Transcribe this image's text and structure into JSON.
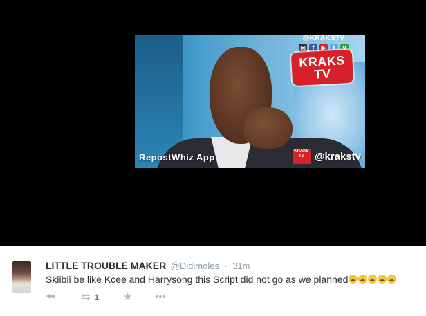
{
  "media": {
    "watermark_top_handle": "@KRAKSTV",
    "badge_line1": "KRAKS",
    "badge_line2": "TV",
    "watermark_left": "RepostWhiz App",
    "mini_badge_text": "KRAKS TV",
    "watermark_handle": "@krakstv"
  },
  "tweet": {
    "fullname": "LITTLE TROUBLE MAKER",
    "username": "@Didimoles",
    "separator": "·",
    "time": "31m",
    "text": "Skiibii be like Kcee and Harrysong this Script did not go as we planned",
    "emoji_count": 5,
    "retweet_count": "1"
  },
  "icons": {
    "reply": "reply-icon",
    "retweet": "retweet-icon",
    "favorite": "star-icon",
    "more": "more-icon"
  },
  "colors": {
    "name_text": "#292f33",
    "meta_text": "#8899a6",
    "action_icon": "#aab8c2",
    "brand_red": "#d6202a"
  }
}
